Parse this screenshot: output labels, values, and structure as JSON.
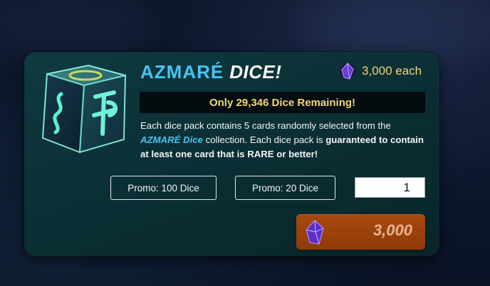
{
  "pack": {
    "title_brand": "AZMARÉ",
    "title_word": "DICE!",
    "price_each": "3,000 each",
    "remaining_text": "Only 29,346 Dice Remaining!",
    "desc_part1": "Each dice pack contains 5 cards randomly selected from the ",
    "desc_brand": "AZMARÉ Dice",
    "desc_part2": " collection. Each dice pack is ",
    "desc_bold": "guaranteed to contain at least one card that is RARE or better!"
  },
  "promos": {
    "promo_100_label": "Promo: 100 Dice",
    "promo_20_label": "Promo: 20 Dice"
  },
  "purchase": {
    "quantity": "1",
    "total": "3,000"
  },
  "icons": {
    "dice": "azmare-dice-icon",
    "gem": "purple-gem-icon"
  },
  "colors": {
    "card_bg": "#0a2e33",
    "brand_blue": "#47c4f3",
    "gold_text": "#f4d678",
    "buy_button": "#9a400b"
  }
}
